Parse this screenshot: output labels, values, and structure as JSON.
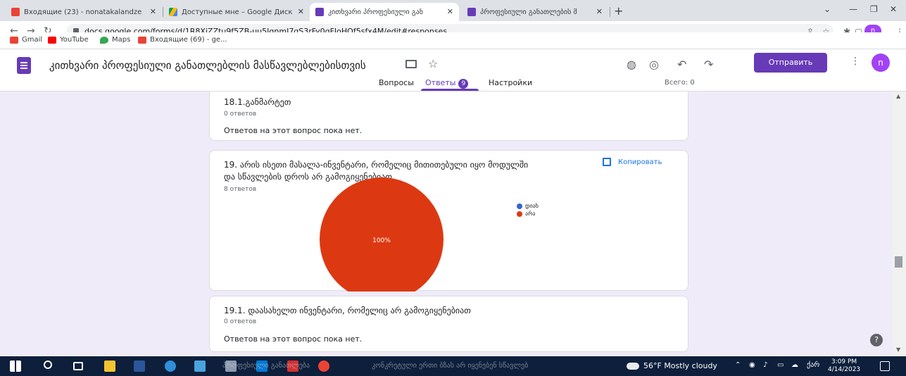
{
  "browser": {
    "tabs": [
      {
        "label": "Входящие (23) - nonatakalandze",
        "icon": "gmail-icon",
        "active": false
      },
      {
        "label": "Доступные мне – Google Диск",
        "icon": "google-drive-icon",
        "active": false
      },
      {
        "label": "კითხვარი პროფესიული გან",
        "icon": "google-forms-icon",
        "active": true
      },
      {
        "label": "პროფესიული განათლების მ",
        "icon": "google-forms-icon",
        "active": false
      }
    ],
    "new_tab": "+",
    "url": "docs.google.com/forms/d/1R8XiZZtu9f5ZB-uu5IqnmJ7qS3rFy0qFIoHQf5sfx4M/edit#responses",
    "profile_letter": "n",
    "bookmarks": [
      {
        "label": "Gmail",
        "icon": "gmail-icon"
      },
      {
        "label": "YouTube",
        "icon": "youtube-icon"
      },
      {
        "label": "Maps",
        "icon": "maps-icon"
      },
      {
        "label": "Входящие (69) - ge...",
        "icon": "gmail-icon"
      }
    ]
  },
  "form": {
    "title": "კითხვარი პროფესიული განათლებლის მასწავლებლებისთვის",
    "send_label": "Отправить",
    "avatar_letter": "n",
    "tabs": {
      "questions": "Вопросы",
      "answers": "Ответы",
      "answers_count": "9",
      "settings": "Настройки"
    },
    "total_label": "Всего: 0"
  },
  "cards": [
    {
      "title": "18.1.განმარტეთ",
      "count": "0 ответов",
      "empty_text": "Ответов на этот вопрос пока нет."
    },
    {
      "title_line1": "19. არის ისეთი მასალა-ინვენტარი, რომელიც მითითებული იყო მოდულში",
      "title_line2": "და სწავლების დროს არ გამოგიყენებიათ.",
      "count": "8 ответов",
      "copy_label": "Копировать"
    },
    {
      "title": "19.1. დაასახელთ ინვენტარი, რომელიც არ გამოგიყენებიათ",
      "count": "0 ответов",
      "empty_text": "Ответов на этот вопрос пока нет."
    }
  ],
  "chart_data": {
    "type": "pie",
    "categories": [
      "დიახ",
      "არა"
    ],
    "values": [
      0,
      100
    ],
    "colors": [
      "#3366cc",
      "#dc3912"
    ],
    "slice_label": "100%",
    "legend": "right"
  },
  "taskbar": {
    "obscured_text_1": "პროფესიული განათლება",
    "obscured_text_2": "კონკრეტული ერთი ბზას არ იყენებენ სწავლებ",
    "weather": "56°F  Mostly cloudy",
    "lang": "ქარ",
    "time": "3:09 PM",
    "date": "4/14/2023"
  }
}
